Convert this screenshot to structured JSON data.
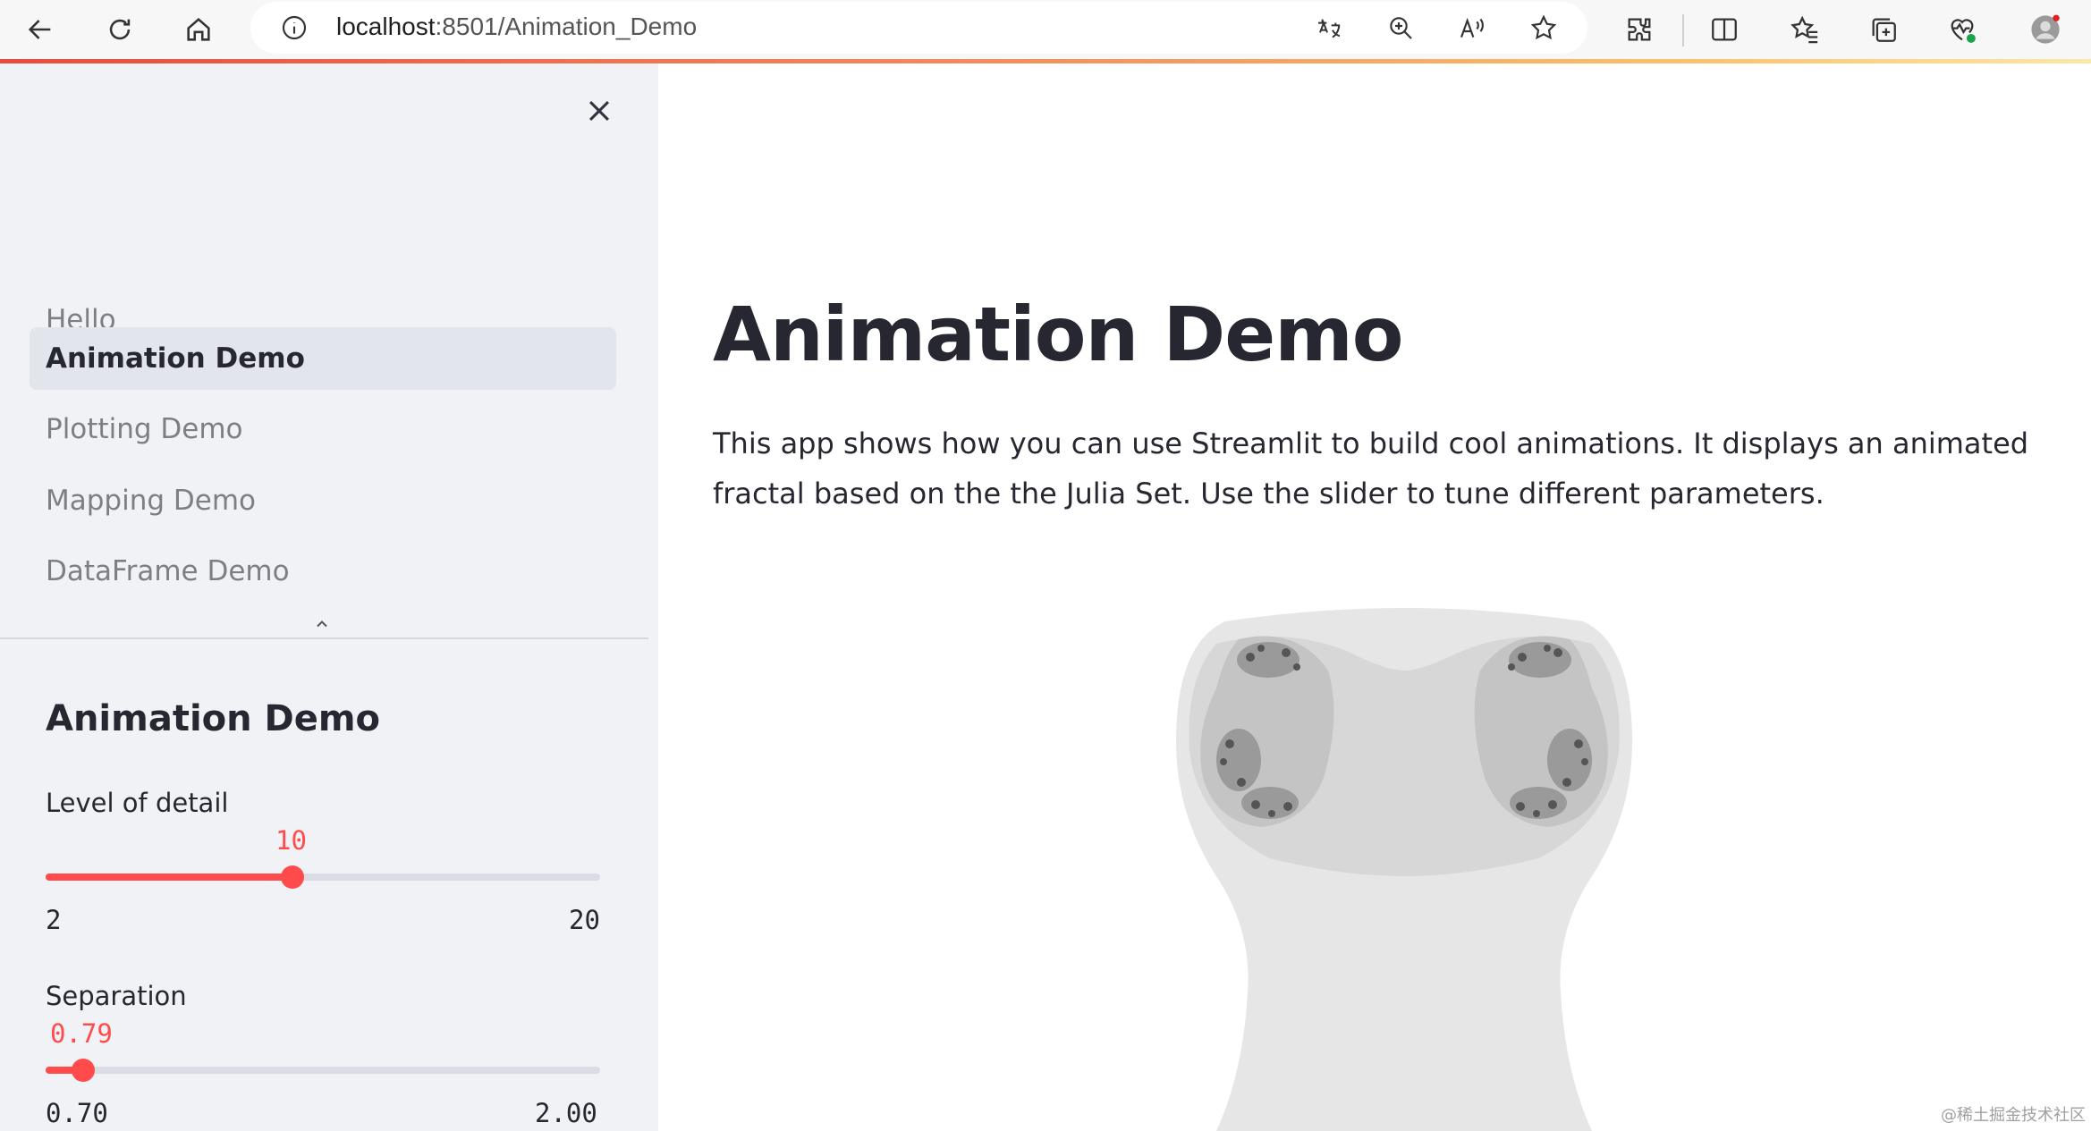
{
  "browser": {
    "url_host": "localhost",
    "url_path": ":8501/Animation_Demo",
    "icons": [
      "back-icon",
      "refresh-icon",
      "home-icon",
      "info-icon",
      "translate-icon",
      "zoom-icon",
      "read-aloud-icon",
      "favorite-star-icon",
      "extensions-icon",
      "split-screen-icon",
      "favorites-icon",
      "collections-icon",
      "performance-icon",
      "profile-avatar"
    ],
    "accent_colors": [
      "#e74c3c",
      "#f8c06a"
    ]
  },
  "sidebar": {
    "nav": [
      {
        "label": "Hello",
        "active": false
      },
      {
        "label": "Animation Demo",
        "active": true
      },
      {
        "label": "Plotting Demo",
        "active": false
      },
      {
        "label": "Mapping Demo",
        "active": false
      },
      {
        "label": "DataFrame Demo",
        "active": false
      }
    ],
    "section_title": "Animation Demo",
    "sliders": [
      {
        "label": "Level of detail",
        "value": "10",
        "min": "2",
        "max": "20",
        "fraction": 0.444
      },
      {
        "label": "Separation",
        "value": "0.79",
        "min": "0.70",
        "max": "2.00",
        "fraction": 0.069
      }
    ],
    "accent_color": "#ff4b4b"
  },
  "main": {
    "title": "Animation Demo",
    "description": "This app shows how you can use Streamlit to build cool animations. It displays an animated fractal based on the the Julia Set. Use the slider to tune different parameters."
  },
  "watermark": "@稀土掘金技术社区"
}
